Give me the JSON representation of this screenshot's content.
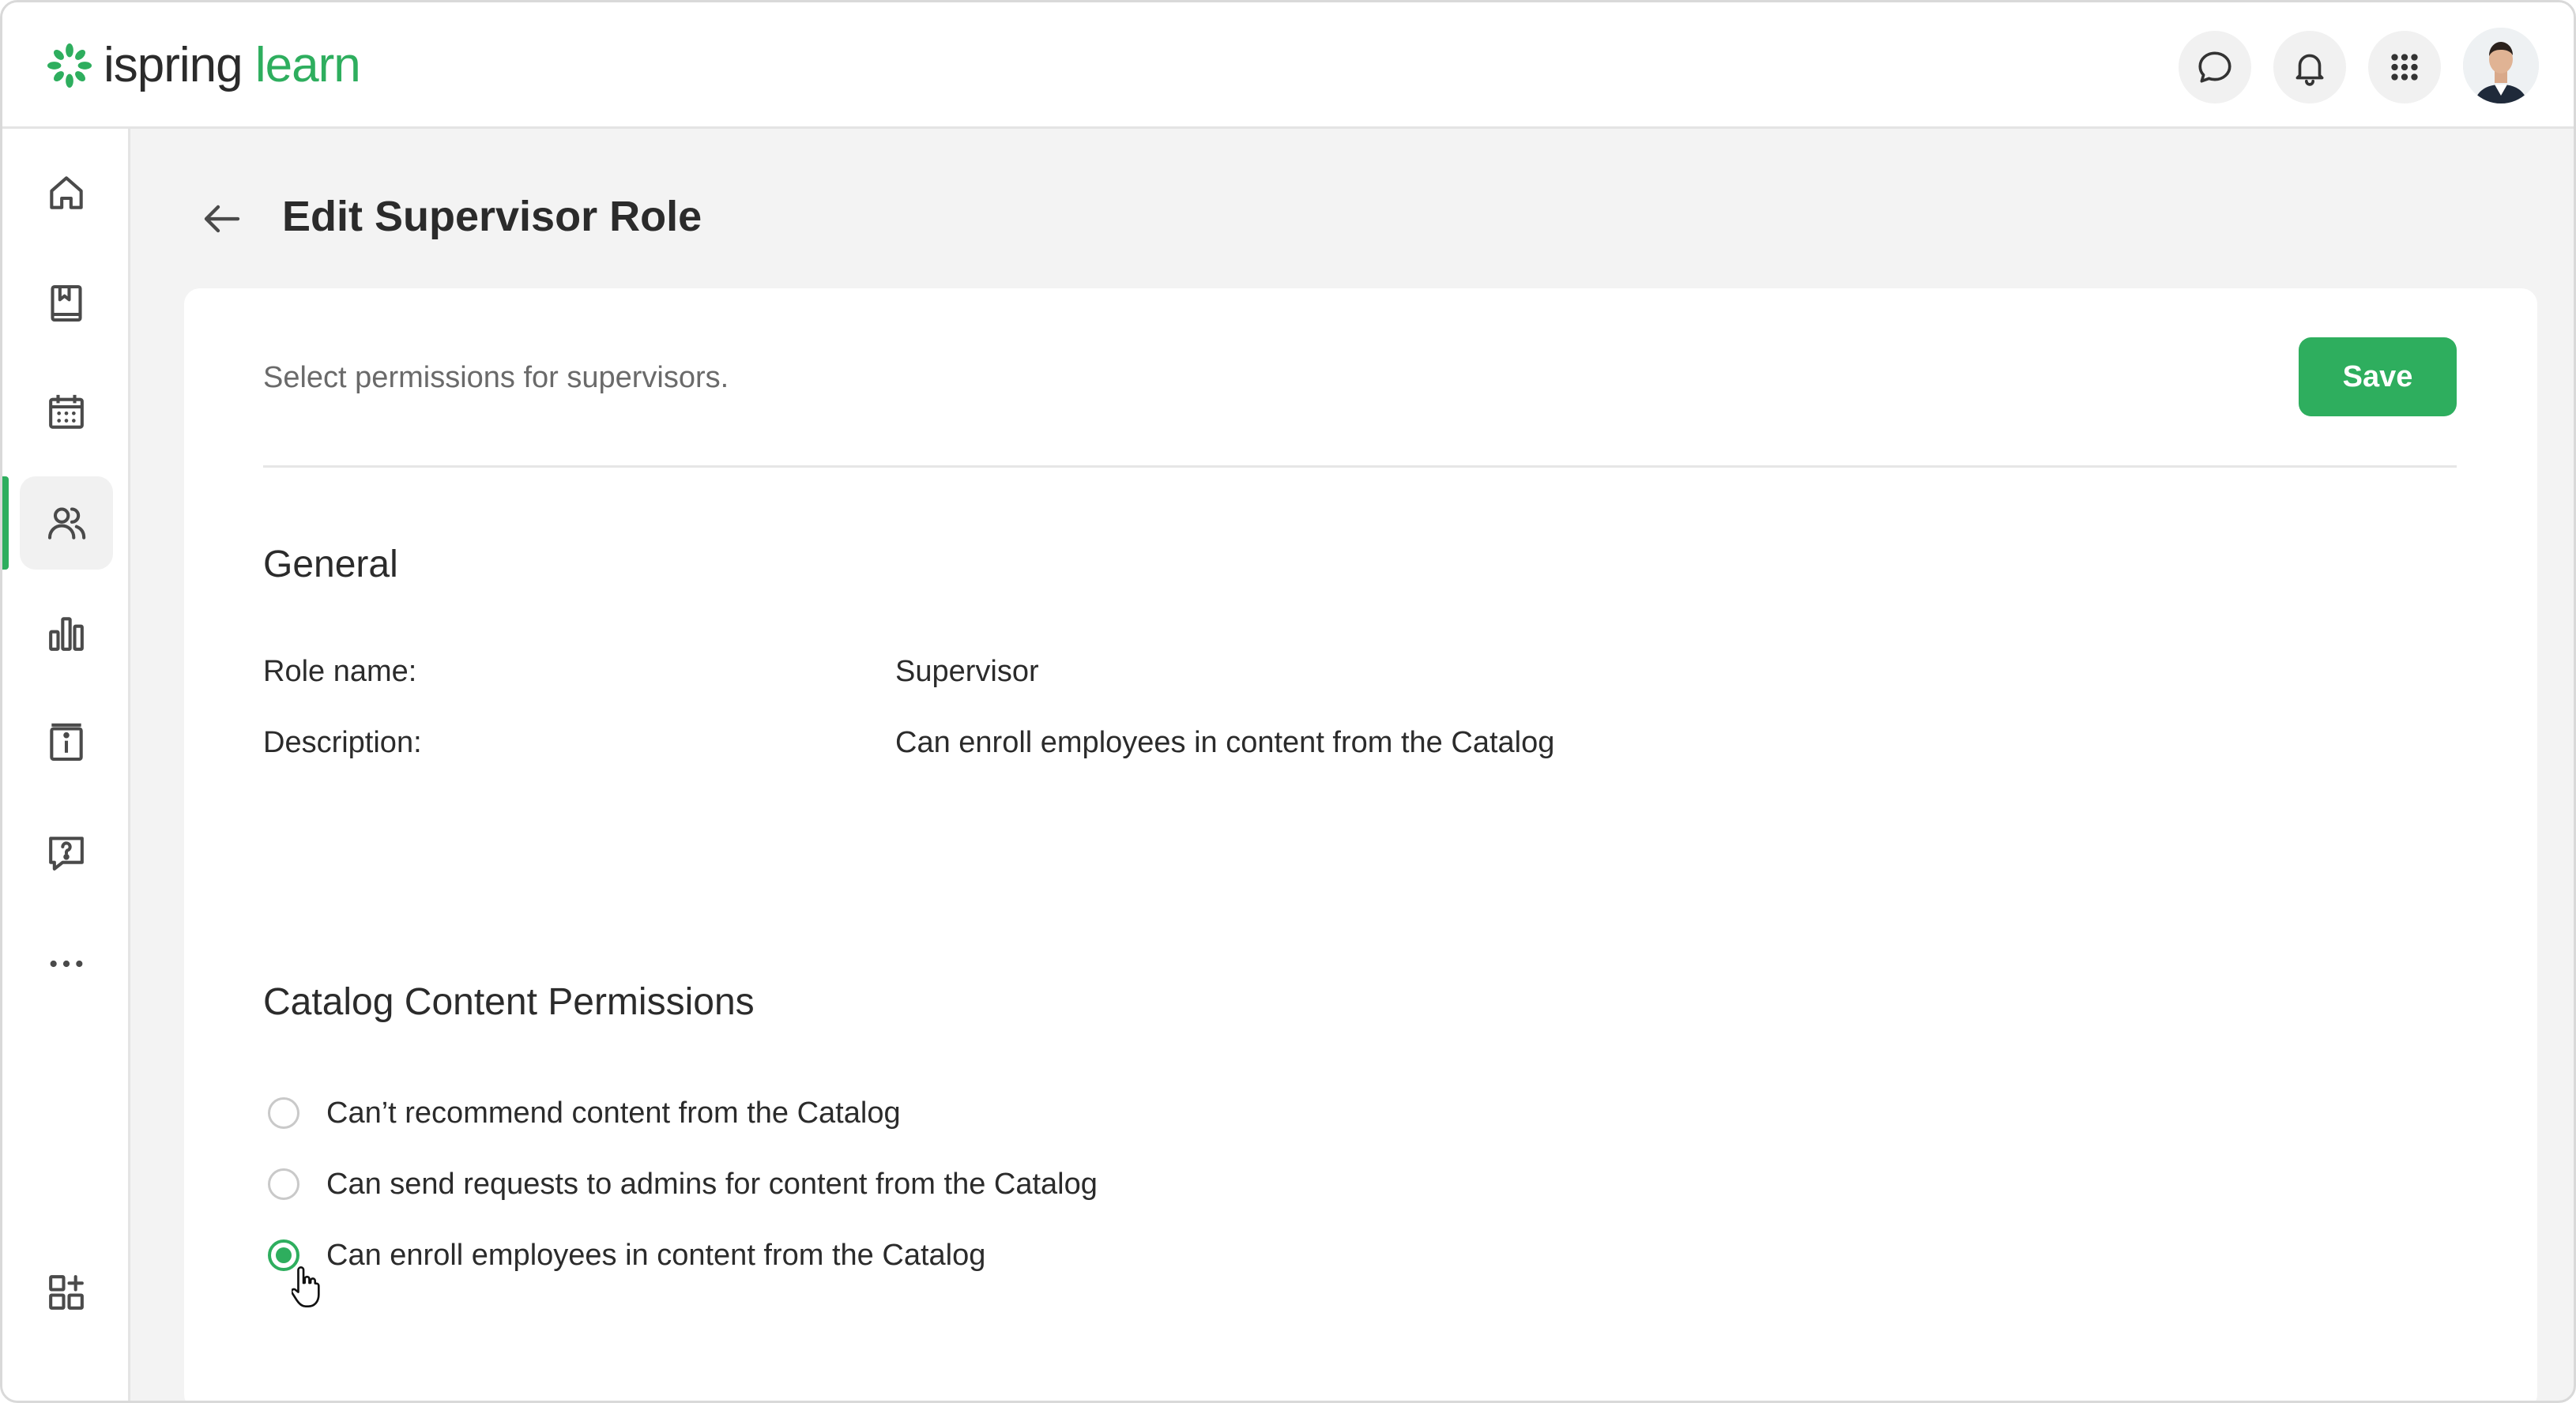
{
  "app": {
    "logo_part1": "ispring",
    "logo_part2": "learn",
    "brand_color": "#2eae5e"
  },
  "header": {
    "icons": [
      "chat-icon",
      "bell-icon",
      "apps-grid-icon"
    ],
    "avatar": "user-avatar"
  },
  "sidebar": {
    "items": [
      {
        "name": "home",
        "icon": "home-icon"
      },
      {
        "name": "library",
        "icon": "book-icon"
      },
      {
        "name": "calendar",
        "icon": "calendar-icon"
      },
      {
        "name": "users",
        "icon": "users-icon",
        "active": true
      },
      {
        "name": "reports",
        "icon": "bar-chart-icon"
      },
      {
        "name": "info",
        "icon": "info-icon"
      },
      {
        "name": "help",
        "icon": "question-chat-icon"
      },
      {
        "name": "more",
        "icon": "more-dots-icon"
      },
      {
        "name": "add-widget",
        "icon": "add-widget-icon"
      }
    ]
  },
  "page": {
    "title": "Edit Supervisor Role",
    "subtitle": "Select permissions for supervisors.",
    "save_label": "Save"
  },
  "general": {
    "title": "General",
    "role_name_label": "Role name:",
    "role_name_value": "Supervisor",
    "description_label": "Description:",
    "description_value": "Can enroll employees in content from the Catalog"
  },
  "catalog": {
    "title": "Catalog Content Permissions",
    "options": [
      {
        "label": "Can’t recommend content from the Catalog",
        "checked": false
      },
      {
        "label": "Can send requests to admins for content from the Catalog",
        "checked": false
      },
      {
        "label": "Can enroll employees in content from the Catalog",
        "checked": true
      }
    ]
  }
}
